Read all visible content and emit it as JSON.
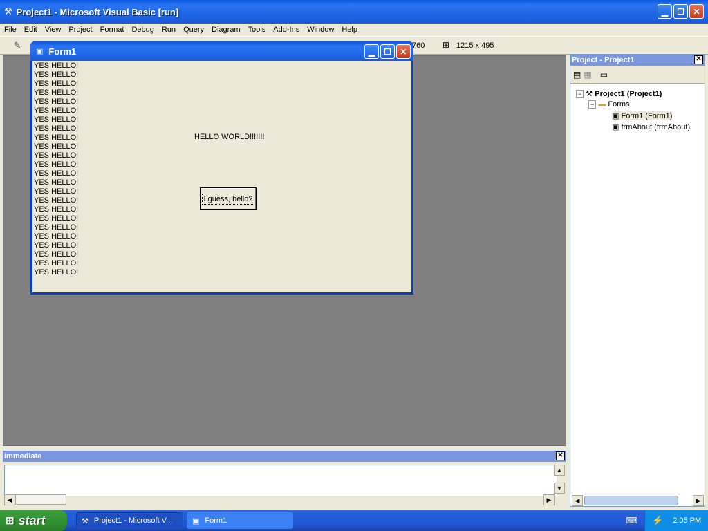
{
  "app": {
    "title": "Project1 - Microsoft Visual Basic [run]"
  },
  "menu": [
    "File",
    "Edit",
    "View",
    "Project",
    "Format",
    "Debug",
    "Run",
    "Query",
    "Diagram",
    "Tools",
    "Add-Ins",
    "Window",
    "Help"
  ],
  "toolbar": {
    "position": "760",
    "size": "1215 x 495"
  },
  "form1": {
    "title": "Form1",
    "lines": [
      "YES HELLO!",
      "YES HELLO!",
      "YES HELLO!",
      "YES HELLO!",
      "YES HELLO!",
      "YES HELLO!",
      "YES HELLO!",
      "YES HELLO!",
      "YES HELLO!",
      "YES HELLO!",
      "YES HELLO!",
      "YES HELLO!",
      "YES HELLO!",
      "YES HELLO!",
      "YES HELLO!",
      "YES HELLO!",
      "YES HELLO!",
      "YES HELLO!",
      "YES HELLO!",
      "YES HELLO!",
      "YES HELLO!",
      "YES HELLO!",
      "YES HELLO!",
      "YES HELLO!"
    ],
    "hello_world": "HELLO WORLD!!!!!!!",
    "button": "I guess, hello?"
  },
  "project_panel": {
    "title": "Project - Project1",
    "root": "Project1 (Project1)",
    "folder": "Forms",
    "items": [
      "Form1 (Form1)",
      "frmAbout (frmAbout)"
    ]
  },
  "immediate": {
    "title": "Immediate"
  },
  "taskbar": {
    "start": "start",
    "tasks": [
      "Project1 - Microsoft V...",
      "Form1"
    ],
    "time": "2:05 PM"
  }
}
